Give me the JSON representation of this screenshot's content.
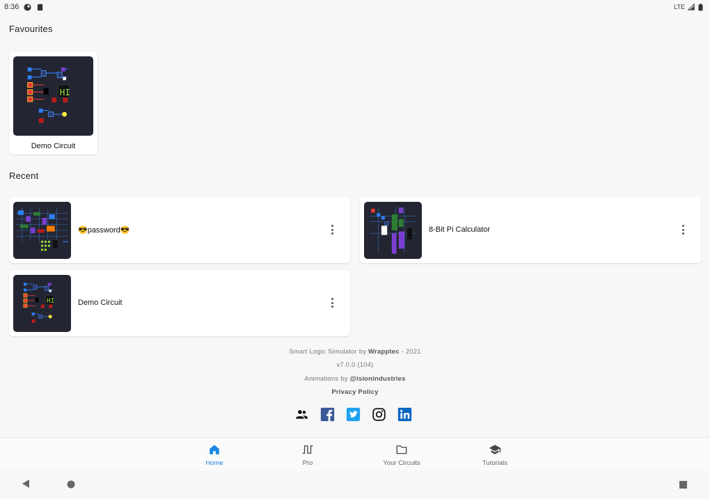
{
  "status_bar": {
    "time": "8:36",
    "network": "LTE"
  },
  "favourites": {
    "title": "Favourites",
    "items": [
      {
        "label": "Demo Circuit"
      }
    ]
  },
  "recent": {
    "title": "Recent",
    "items": [
      {
        "label": "😎password😎"
      },
      {
        "label": "8-Bit Pi Calculator"
      },
      {
        "label": "Demo Circuit"
      }
    ]
  },
  "footer": {
    "credit_prefix": "Smart Logic Simulator by ",
    "credit_author": "Wrapptec",
    "credit_suffix": " - 2021",
    "version": "v7.0.0 (104)",
    "animations_prefix": "Animations by ",
    "animations_author": "@isionindustries",
    "privacy": "Privacy Policy"
  },
  "social_icons": [
    "community-icon",
    "facebook-icon",
    "twitter-icon",
    "instagram-icon",
    "linkedin-icon"
  ],
  "bottom_nav": {
    "items": [
      {
        "label": "Home",
        "icon": "home-icon",
        "active": true
      },
      {
        "label": "Pro",
        "icon": "pulse-wave-icon",
        "active": false
      },
      {
        "label": "Your Circuits",
        "icon": "folder-icon",
        "active": false
      },
      {
        "label": "Tutorials",
        "icon": "graduation-cap-icon",
        "active": false
      }
    ]
  },
  "colors": {
    "accent": "#1e88e5",
    "background": "#f7f7f7",
    "thumb_bg": "#232632",
    "facebook": "#3b5998",
    "twitter": "#1da1f2",
    "linkedin": "#0a66c2"
  }
}
